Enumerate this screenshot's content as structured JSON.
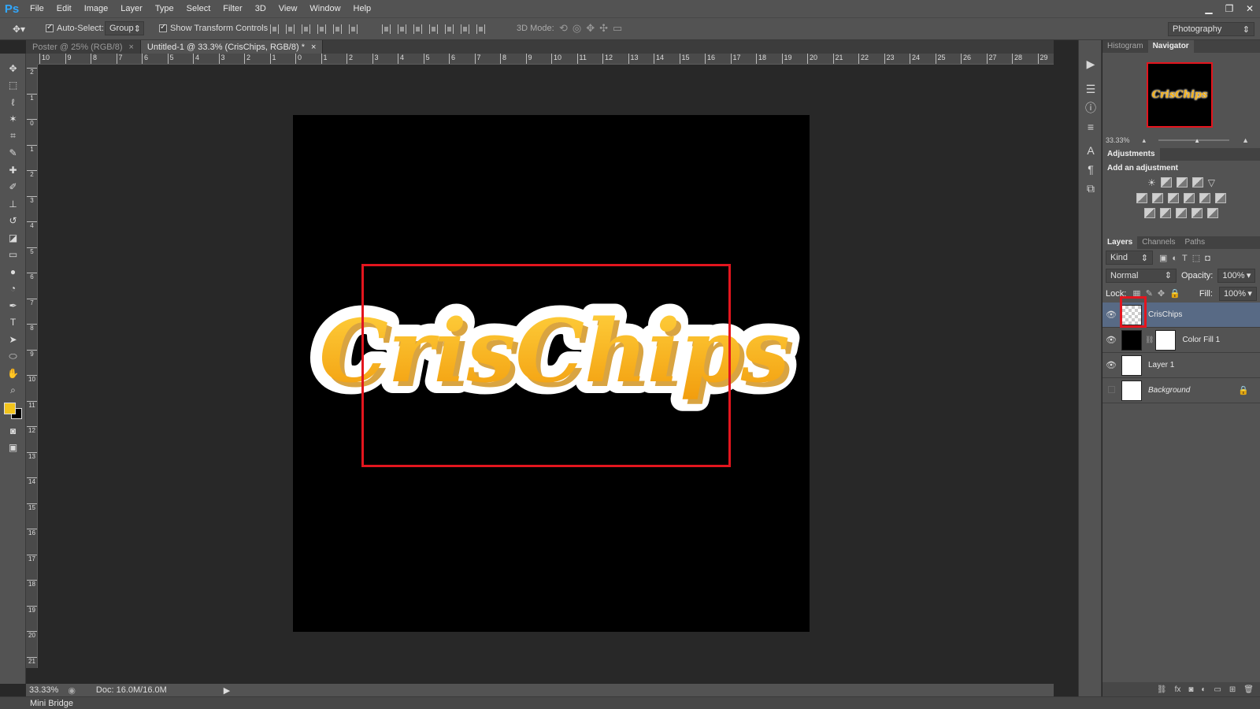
{
  "app": {
    "logo": "Ps",
    "menu": [
      "File",
      "Edit",
      "Image",
      "Layer",
      "Type",
      "Select",
      "Filter",
      "3D",
      "View",
      "Window",
      "Help"
    ]
  },
  "window_controls": {
    "minimize": "▁",
    "restore": "❐",
    "close": "✕"
  },
  "options_bar": {
    "auto_select_label": "Auto-Select:",
    "auto_select_value": "Group",
    "show_transform_label": "Show Transform Controls",
    "mode_3d_label": "3D Mode:",
    "workspace": "Photography"
  },
  "tabs": [
    {
      "label": "Poster @ 25% (RGB/8)",
      "close": "×"
    },
    {
      "label": "Untitled-1 @ 33.3% (CrisChips, RGB/8) *",
      "close": "×"
    }
  ],
  "ruler_top": [
    "10",
    "9",
    "8",
    "7",
    "6",
    "5",
    "4",
    "3",
    "2",
    "1",
    "0",
    "1",
    "2",
    "3",
    "4",
    "5",
    "6",
    "7",
    "8",
    "9",
    "10",
    "11",
    "12",
    "13",
    "14",
    "15",
    "16",
    "17",
    "18",
    "19",
    "20",
    "21",
    "22",
    "23",
    "24",
    "25",
    "26",
    "27",
    "28",
    "29"
  ],
  "ruler_left": [
    "2",
    "1",
    "0",
    "1",
    "2",
    "3",
    "4",
    "5",
    "6",
    "7",
    "8",
    "9",
    "10",
    "11",
    "12",
    "13",
    "14",
    "15",
    "16",
    "17",
    "18",
    "19",
    "20",
    "21"
  ],
  "canvas": {
    "logo_text": "CrisChips",
    "accent": "#f6b21a",
    "selection_color": "#e3151e"
  },
  "status": {
    "zoom": "33.33%",
    "doc": "Doc: 16.0M/16.0M"
  },
  "mini_bridge": "Mini Bridge",
  "panels": {
    "top_tabs": [
      "Histogram",
      "Navigator"
    ],
    "navigator_zoom": "33.33%",
    "adjustments_title": "Adjustments",
    "adjustments_subtitle": "Add an adjustment",
    "layers_tabs": [
      "Layers",
      "Channels",
      "Paths"
    ],
    "filter_kind": "Kind",
    "blend_mode": "Normal",
    "opacity_label": "Opacity:",
    "opacity_value": "100%",
    "lock_label": "Lock:",
    "fill_label": "Fill:",
    "fill_value": "100%",
    "layers": [
      {
        "name": "CrisChips",
        "selected": true
      },
      {
        "name": "Color Fill 1",
        "selected": false
      },
      {
        "name": "Layer 1",
        "selected": false
      },
      {
        "name": "Background",
        "selected": false
      }
    ]
  }
}
